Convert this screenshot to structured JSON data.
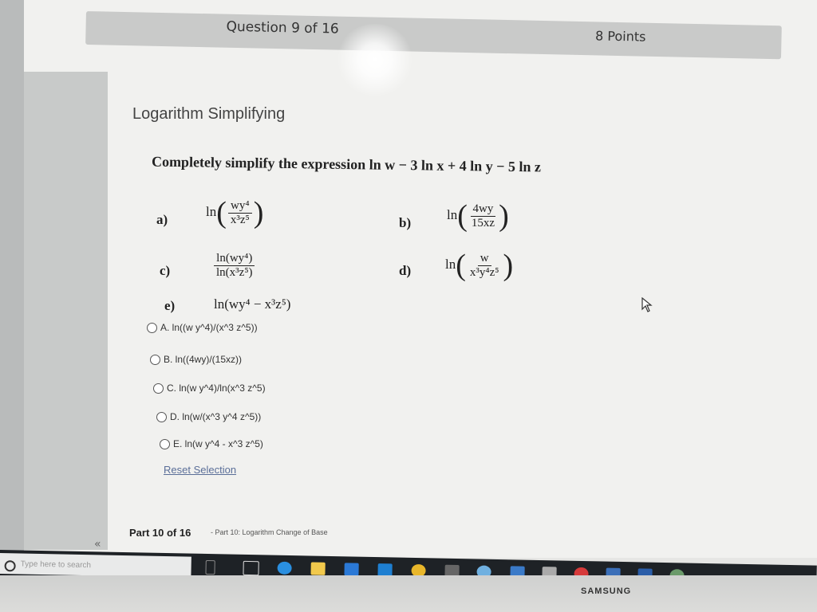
{
  "header": {
    "question": "Question 9 of 16",
    "points": "8 Points"
  },
  "title": "Logarithm Simplifying",
  "prompt": "Completely simplify the expression ln w − 3 ln x + 4 ln y − 5 ln z",
  "options": [
    {
      "letter": "a)",
      "expr_ln": "ln",
      "num": "wy⁴",
      "den": "x³z⁵"
    },
    {
      "letter": "b)",
      "expr_ln": "ln",
      "num": "4wy",
      "den": "15xz"
    },
    {
      "letter": "c)",
      "num": "ln(wy⁴)",
      "den": "ln(x³z⁵)"
    },
    {
      "letter": "d)",
      "expr_ln": "ln",
      "num": "w",
      "den": "x³y⁴z⁵"
    },
    {
      "letter": "e)",
      "expr": "ln(wy⁴ − x³z⁵)"
    }
  ],
  "choices": [
    {
      "label": "A. ln((w y^4)/(x^3 z^5))"
    },
    {
      "label": "B. ln((4wy)/(15xz))"
    },
    {
      "label": "C. ln(w y^4)/ln(x^3 z^5)"
    },
    {
      "label": "D. ln(w/(x^3 y^4 z^5))"
    },
    {
      "label": "E. ln(w y^4 - x^3 z^5)"
    }
  ],
  "reset_label": "Reset Selection",
  "footer": {
    "part": "Part 10 of 16",
    "part_sub": "- Part 10: Logarithm Change of Base",
    "collapse": "«"
  },
  "taskbar": {
    "search_placeholder": "Type here to search"
  },
  "monitor_brand": "SAMSUNG",
  "colors": {
    "header_bar": "#c9cac9",
    "link": "#5a6e98",
    "taskbar": "#1e2226"
  }
}
